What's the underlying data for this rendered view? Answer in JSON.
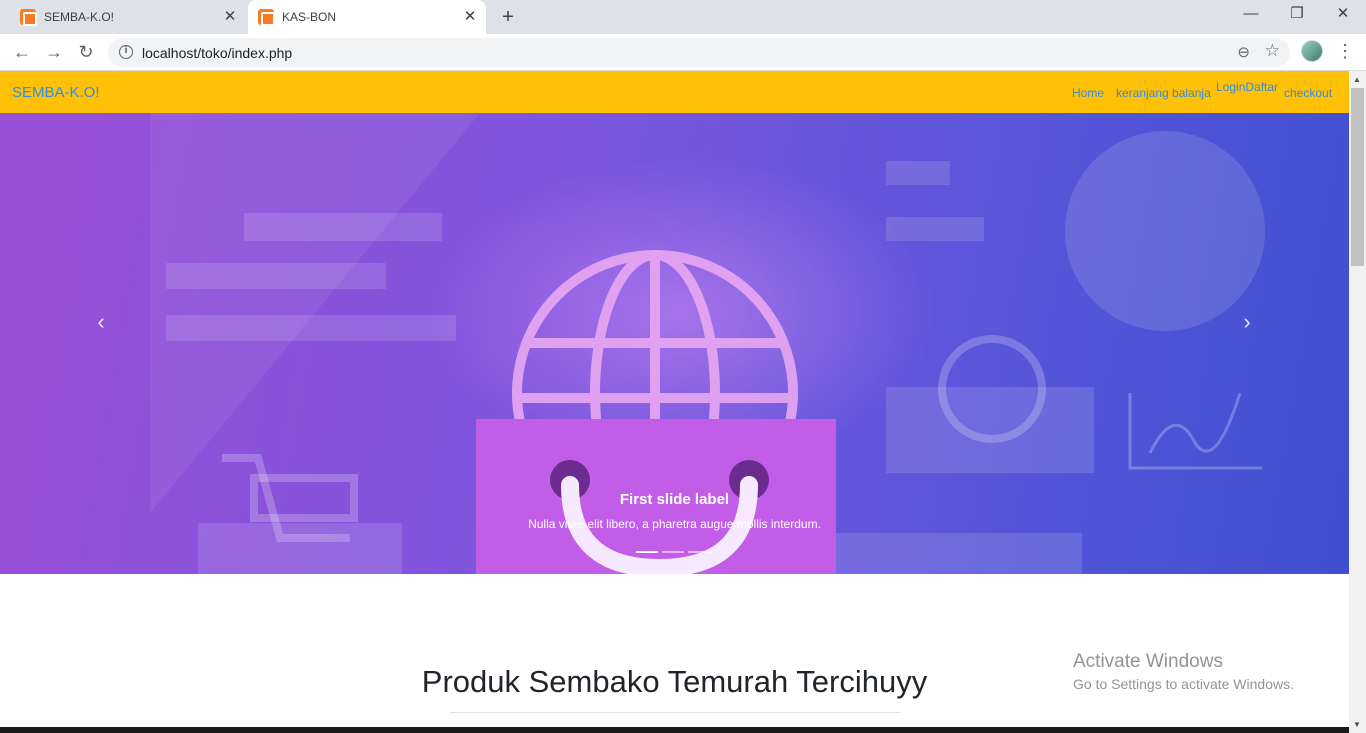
{
  "browser": {
    "tabs": [
      {
        "title": "SEMBA-K.O!",
        "active": false
      },
      {
        "title": "KAS-BON",
        "active": true
      }
    ],
    "new_tab": "+",
    "window_controls": {
      "minimize": "—",
      "restore": "❐",
      "close": "✕"
    },
    "url": "localhost/toko/index.php"
  },
  "navbar": {
    "brand": "SEMBA-K.O!",
    "links": [
      "Home",
      "keranjang balanja",
      "LoginDaftar",
      "checkout"
    ],
    "bg_color": "#ffc107",
    "link_color": "#2f8de4"
  },
  "carousel": {
    "caption_title": "First slide label",
    "caption_text": "Nulla vitae elit libero, a pharetra augue mollis interdum.",
    "prev": "‹",
    "next": "›",
    "active_indicator": 0,
    "indicator_count": 3
  },
  "section": {
    "title": "Produk Sembako Temurah Tercihuyy"
  },
  "os_overlay": {
    "line1": "Activate Windows",
    "line2": "Go to Settings to activate Windows."
  }
}
